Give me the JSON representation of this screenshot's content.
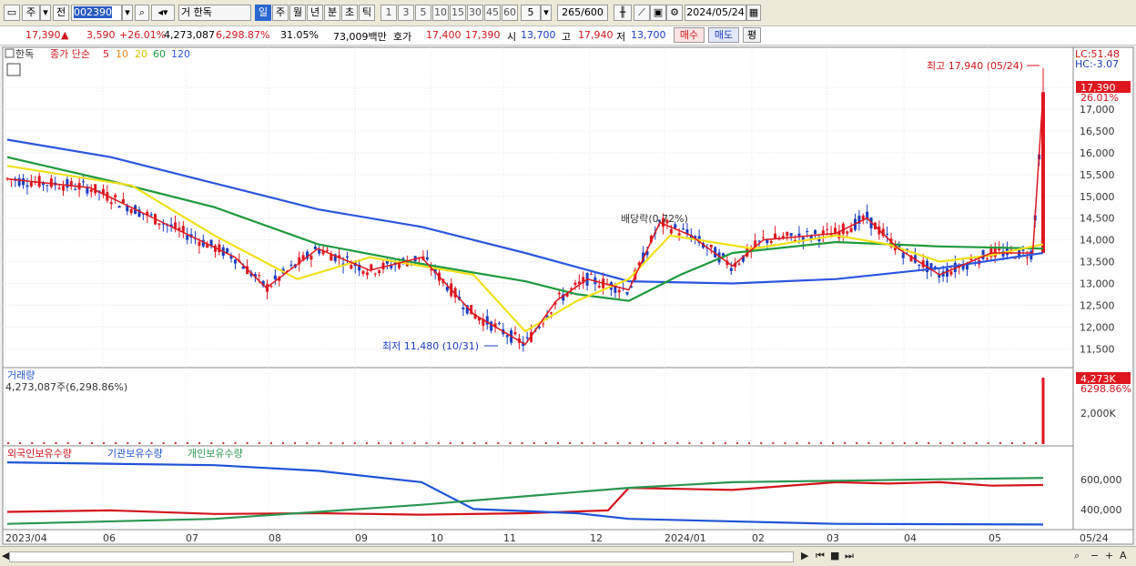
{
  "toolbar": {
    "market": "주",
    "prev": "전",
    "code": "002390",
    "stock_name": "한독",
    "periods": [
      "일",
      "주",
      "월",
      "년",
      "분",
      "초",
      "틱"
    ],
    "active_period": "일",
    "intervals": [
      "1",
      "3",
      "5",
      "10",
      "15",
      "30",
      "45",
      "60"
    ],
    "interval_value": "5",
    "count_text": "265/600",
    "date": "2024/05/24"
  },
  "quote": {
    "price": "17,390",
    "change": "3,590",
    "change_pct": "+26.01%",
    "volume": "4,273,087",
    "vol_pct": "6,298.87%",
    "turnover": "31.05%",
    "amount": "73,009백만",
    "ask_label": "호가",
    "ask1": "17,400",
    "ask2": "17,390",
    "open_label": "시",
    "open": "13,700",
    "high_label": "고",
    "high": "17,940",
    "low_label": "저",
    "low": "13,700",
    "buy_label": "매수",
    "sell_label": "매도",
    "eval_label": "평"
  },
  "price_panel": {
    "name": "한독",
    "legend_title": "종가 단순",
    "ma_labels": [
      "5",
      "10",
      "20",
      "60",
      "120"
    ],
    "lc_label": "LC:51.48",
    "hc_label": "HC:-3.07",
    "max_label": "최고 17,940 (05/24)",
    "min_label": "최저 11,480 (10/31)",
    "div_label": "배당락(0.72%)",
    "current_price_tag": "17,390",
    "current_pct_tag": "26.01%"
  },
  "volume_panel": {
    "title": "거래량",
    "value_text": "4,273,087주(6,298.86%)",
    "tag_value": "4,273K",
    "tag_pct": "6298.86%"
  },
  "holding_panel": {
    "legend": [
      "외국인보유수량",
      "기관보유수량",
      "개인보유수량"
    ]
  },
  "date_axis": [
    "2023/04",
    "06",
    "07",
    "08",
    "09",
    "10",
    "11",
    "12",
    "2024/01",
    "02",
    "03",
    "04",
    "05",
    "05/24"
  ],
  "colors": {
    "ma5": "#e0161e",
    "ma10": "#f08a18",
    "ma20": "#f3e01a",
    "ma60": "#1f9a3c",
    "ma120": "#2a56e0",
    "up": "#e0161e",
    "down": "#1a3cc4",
    "foreign": "#d4141c",
    "institution": "#1f54d8",
    "individual": "#2b9650"
  },
  "chart_data": {
    "type": "line",
    "price_axis": {
      "ticks": [
        11500,
        12000,
        12500,
        13000,
        13500,
        14000,
        14500,
        15000,
        15500,
        16000,
        16500,
        17000,
        17500
      ],
      "ylim": [
        11150,
        18150
      ]
    },
    "volume_axis": {
      "ticks": [
        2000000
      ]
    },
    "holding_axis": {
      "ticks": [
        400000,
        600000
      ]
    },
    "ma120": [
      [
        0,
        16300
      ],
      [
        0.1,
        15900
      ],
      [
        0.2,
        15300
      ],
      [
        0.3,
        14700
      ],
      [
        0.4,
        14300
      ],
      [
        0.5,
        13700
      ],
      [
        0.6,
        13050
      ],
      [
        0.7,
        13000
      ],
      [
        0.8,
        13100
      ],
      [
        0.9,
        13350
      ],
      [
        1.0,
        13700
      ]
    ],
    "ma60": [
      [
        0,
        15900
      ],
      [
        0.1,
        15350
      ],
      [
        0.2,
        14750
      ],
      [
        0.3,
        13900
      ],
      [
        0.4,
        13450
      ],
      [
        0.5,
        13050
      ],
      [
        0.55,
        12750
      ],
      [
        0.6,
        12600
      ],
      [
        0.65,
        13200
      ],
      [
        0.7,
        13700
      ],
      [
        0.8,
        13950
      ],
      [
        0.9,
        13850
      ],
      [
        1.0,
        13800
      ]
    ],
    "ma20": [
      [
        0,
        15700
      ],
      [
        0.12,
        15250
      ],
      [
        0.2,
        14100
      ],
      [
        0.28,
        13100
      ],
      [
        0.35,
        13600
      ],
      [
        0.45,
        13200
      ],
      [
        0.5,
        11900
      ],
      [
        0.55,
        12600
      ],
      [
        0.6,
        13100
      ],
      [
        0.64,
        14100
      ],
      [
        0.72,
        13800
      ],
      [
        0.8,
        14100
      ],
      [
        0.85,
        13900
      ],
      [
        0.9,
        13500
      ],
      [
        0.95,
        13650
      ],
      [
        1.0,
        13900
      ]
    ],
    "ma5": [
      [
        0,
        15400
      ],
      [
        0.08,
        15200
      ],
      [
        0.15,
        14400
      ],
      [
        0.22,
        13600
      ],
      [
        0.25,
        12900
      ],
      [
        0.3,
        13800
      ],
      [
        0.35,
        13300
      ],
      [
        0.4,
        13600
      ],
      [
        0.45,
        12300
      ],
      [
        0.5,
        11600
      ],
      [
        0.53,
        12600
      ],
      [
        0.56,
        13100
      ],
      [
        0.6,
        12850
      ],
      [
        0.63,
        14400
      ],
      [
        0.66,
        14100
      ],
      [
        0.7,
        13400
      ],
      [
        0.73,
        14000
      ],
      [
        0.8,
        14150
      ],
      [
        0.83,
        14500
      ],
      [
        0.86,
        13800
      ],
      [
        0.9,
        13200
      ],
      [
        0.95,
        13700
      ],
      [
        0.99,
        13700
      ],
      [
        1.0,
        17390
      ]
    ],
    "holdings": {
      "foreign": [
        [
          0,
          430000
        ],
        [
          0.1,
          440000
        ],
        [
          0.2,
          415000
        ],
        [
          0.3,
          420000
        ],
        [
          0.4,
          410000
        ],
        [
          0.5,
          420000
        ],
        [
          0.58,
          440000
        ],
        [
          0.6,
          600000
        ],
        [
          0.7,
          585000
        ],
        [
          0.8,
          640000
        ],
        [
          0.85,
          630000
        ],
        [
          0.9,
          640000
        ],
        [
          0.95,
          615000
        ],
        [
          1.0,
          620000
        ]
      ],
      "institution": [
        [
          0,
          780000
        ],
        [
          0.2,
          760000
        ],
        [
          0.3,
          720000
        ],
        [
          0.4,
          640000
        ],
        [
          0.45,
          450000
        ],
        [
          0.55,
          420000
        ],
        [
          0.6,
          380000
        ],
        [
          0.8,
          345000
        ],
        [
          1.0,
          340000
        ]
      ],
      "individual": [
        [
          0,
          345000
        ],
        [
          0.2,
          380000
        ],
        [
          0.3,
          430000
        ],
        [
          0.4,
          480000
        ],
        [
          0.5,
          540000
        ],
        [
          0.6,
          600000
        ],
        [
          0.7,
          640000
        ],
        [
          0.8,
          650000
        ],
        [
          0.9,
          660000
        ],
        [
          1.0,
          670000
        ]
      ]
    }
  }
}
